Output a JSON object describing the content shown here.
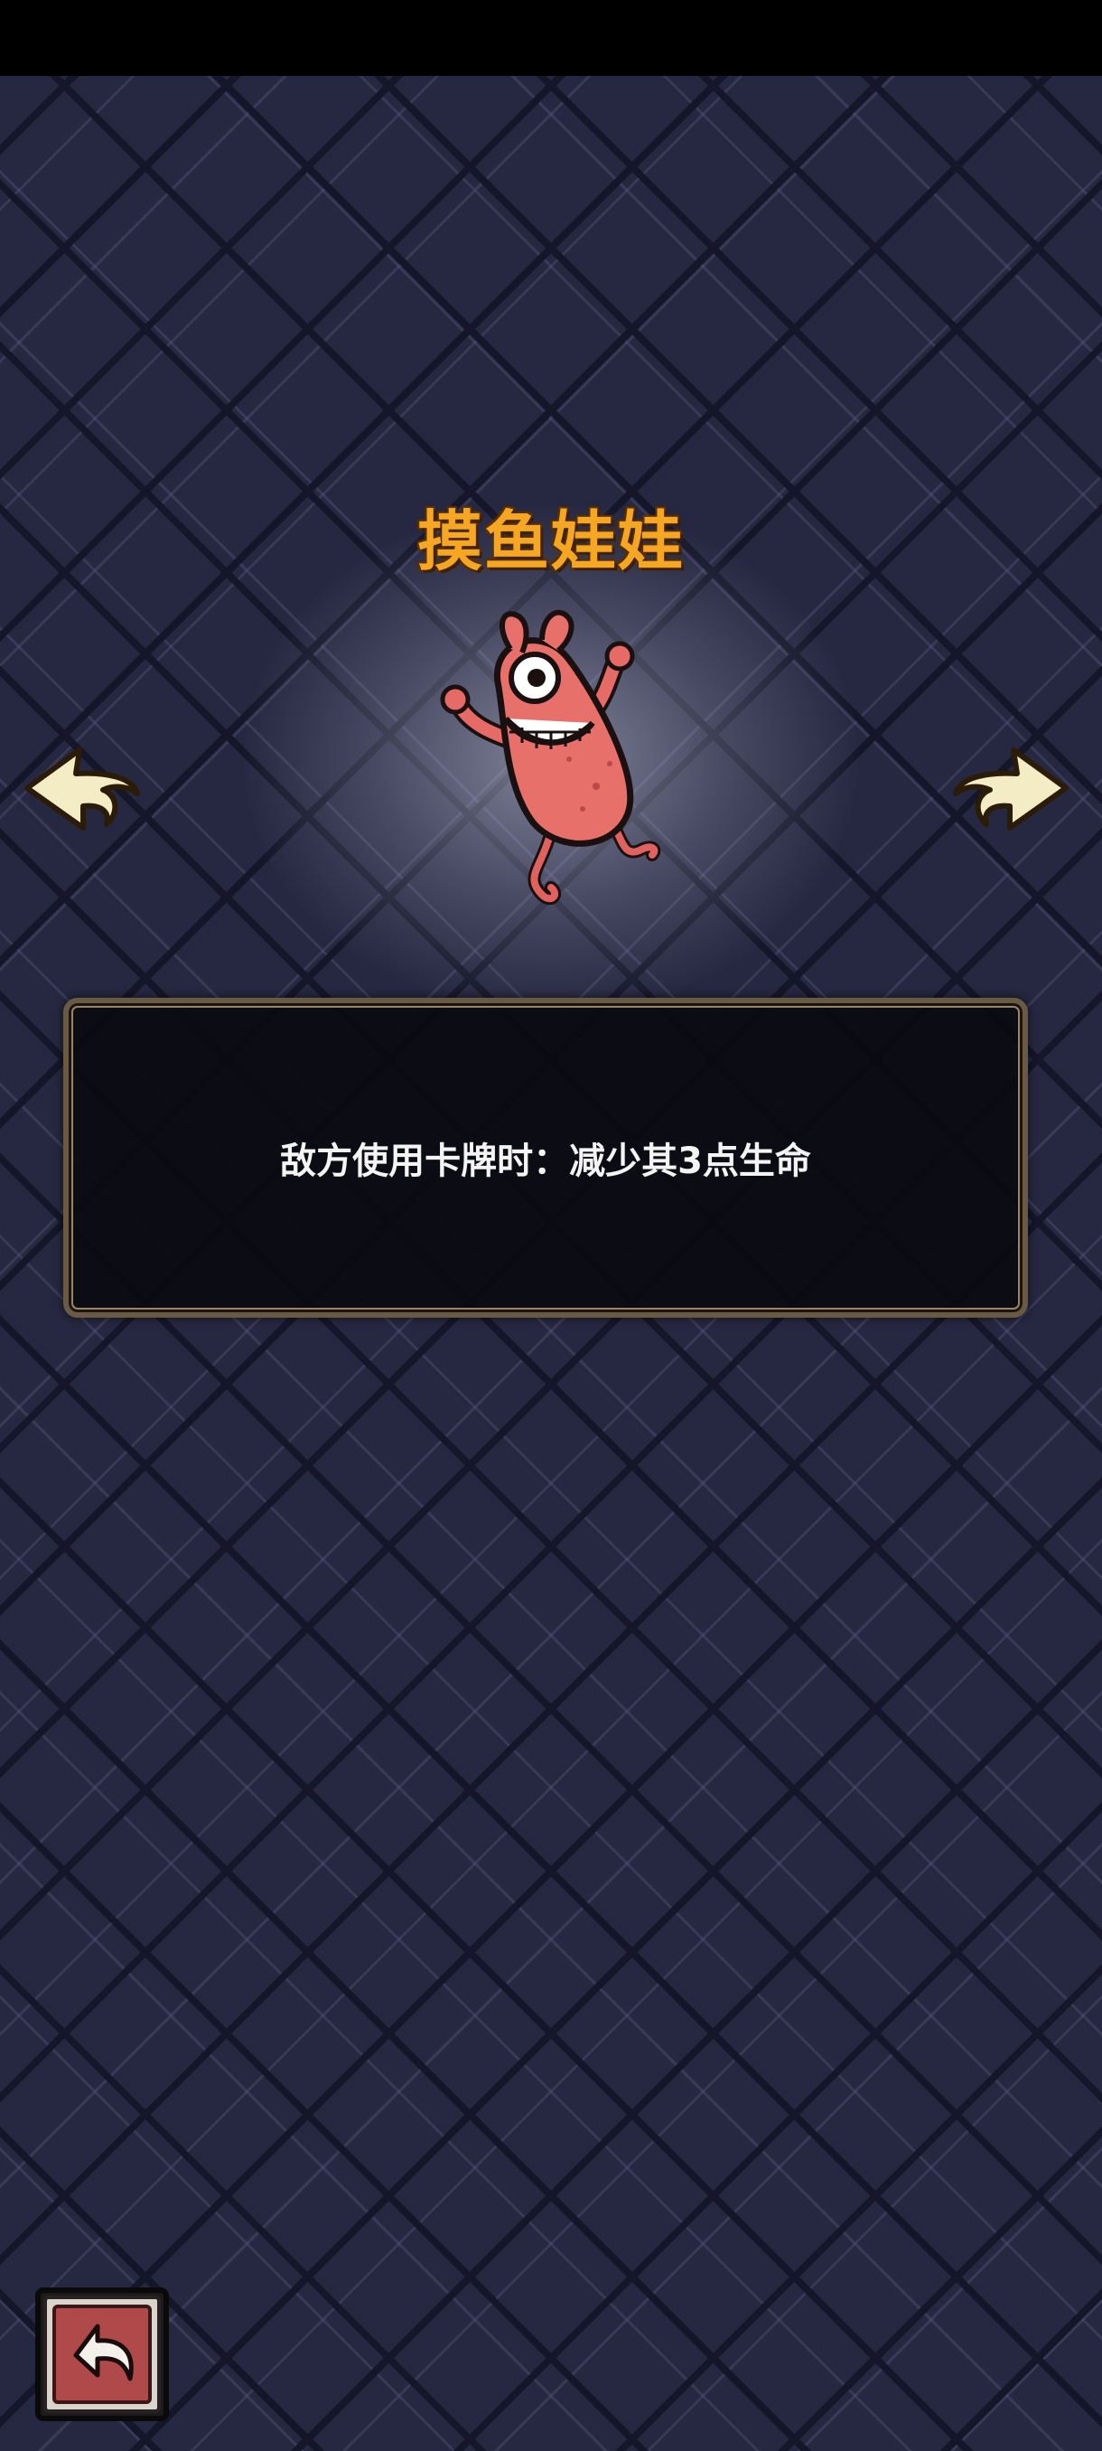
{
  "monster": {
    "name": "摸鱼娃娃",
    "description": "敌方使用卡牌时：减少其3点生命"
  },
  "icons": {
    "prev": "arrow-left-icon",
    "next": "arrow-right-icon",
    "back": "return-arrow-icon"
  },
  "colors": {
    "title": "#f5a623",
    "panel_border": "#6a5a44",
    "arrow_fill": "#f3ecc4",
    "back_button": "#b04a4a"
  }
}
